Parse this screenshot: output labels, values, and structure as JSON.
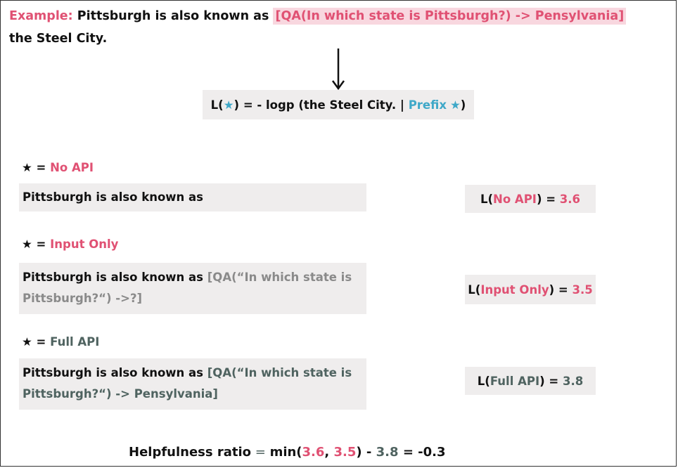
{
  "example": {
    "label": "Example:",
    "text_before": "Pittsburgh is also known as",
    "api_call": "[QA(In which state is Pittsburgh?) -> Pensylvania]",
    "text_after": "the Steel City."
  },
  "formula": {
    "lhs_open": "L(",
    "lhs_close": ") = - logp (the Steel City. | ",
    "prefix": "Prefix",
    "close": ")"
  },
  "cases": [
    {
      "star_eq": "= ",
      "name": "No API",
      "prefix_text": "Pittsburgh is also known as",
      "api_text": "",
      "loss_open": "L(",
      "loss_close": ") = ",
      "loss_value": "3.6"
    },
    {
      "star_eq": "= ",
      "name": "Input Only",
      "prefix_text": "Pittsburgh is also known as ",
      "api_text": "[QA(“In which state is Pittsburgh?“) ->?]",
      "loss_open": "L(",
      "loss_close": ") = ",
      "loss_value": "3.5"
    },
    {
      "star_eq": "= ",
      "name": "Full API",
      "prefix_text": "Pittsburgh is also known as ",
      "api_text": "[QA(“In which state is Pittsburgh?“) -> Pensylvania]",
      "loss_open": "L(",
      "loss_close": ") = ",
      "loss_value": "3.8"
    }
  ],
  "helpfulness": {
    "label": "Helpfulness ratio",
    "eq": " = ",
    "min_open": "min(",
    "a": "3.6",
    "comma": ", ",
    "b": "3.5",
    "min_close": ") - ",
    "c": "3.8",
    "result": " = -0.3"
  },
  "icons": {
    "star_filled": "★",
    "star_blue": "★"
  },
  "colors": {
    "pink": "#e05173",
    "blue": "#3fa8c8",
    "slate": "#4f6360",
    "grey": "#8a8a8a",
    "box": "#efeded",
    "highlight": "#f8d7df"
  }
}
